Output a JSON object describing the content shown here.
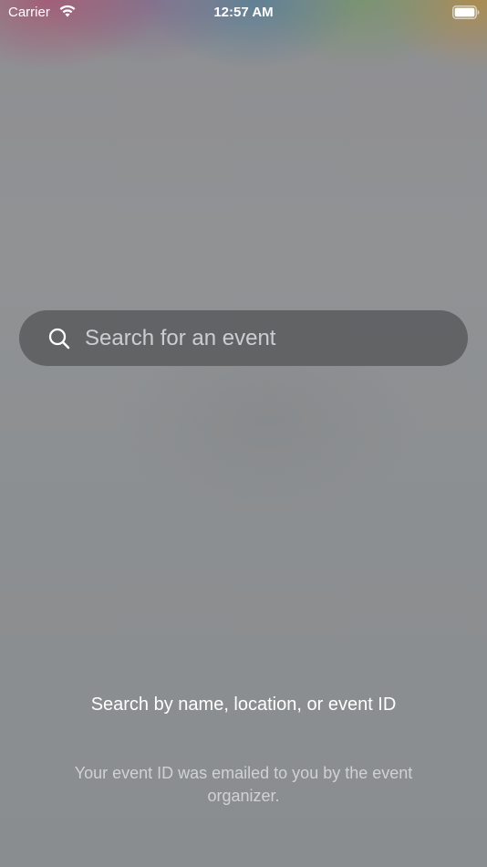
{
  "status_bar": {
    "carrier": "Carrier",
    "time": "12:57 AM",
    "wifi_icon": "wifi-icon",
    "battery_icon": "battery-icon"
  },
  "search": {
    "placeholder": "Search for an event",
    "value": "",
    "icon": "search-icon"
  },
  "hint": {
    "title": "Search by name, location, or event ID",
    "subtitle": "Your event ID was emailed to you by the event organizer."
  },
  "colors": {
    "background": "#8d9092",
    "search_field": "#58595c",
    "text_primary": "#ffffff"
  }
}
